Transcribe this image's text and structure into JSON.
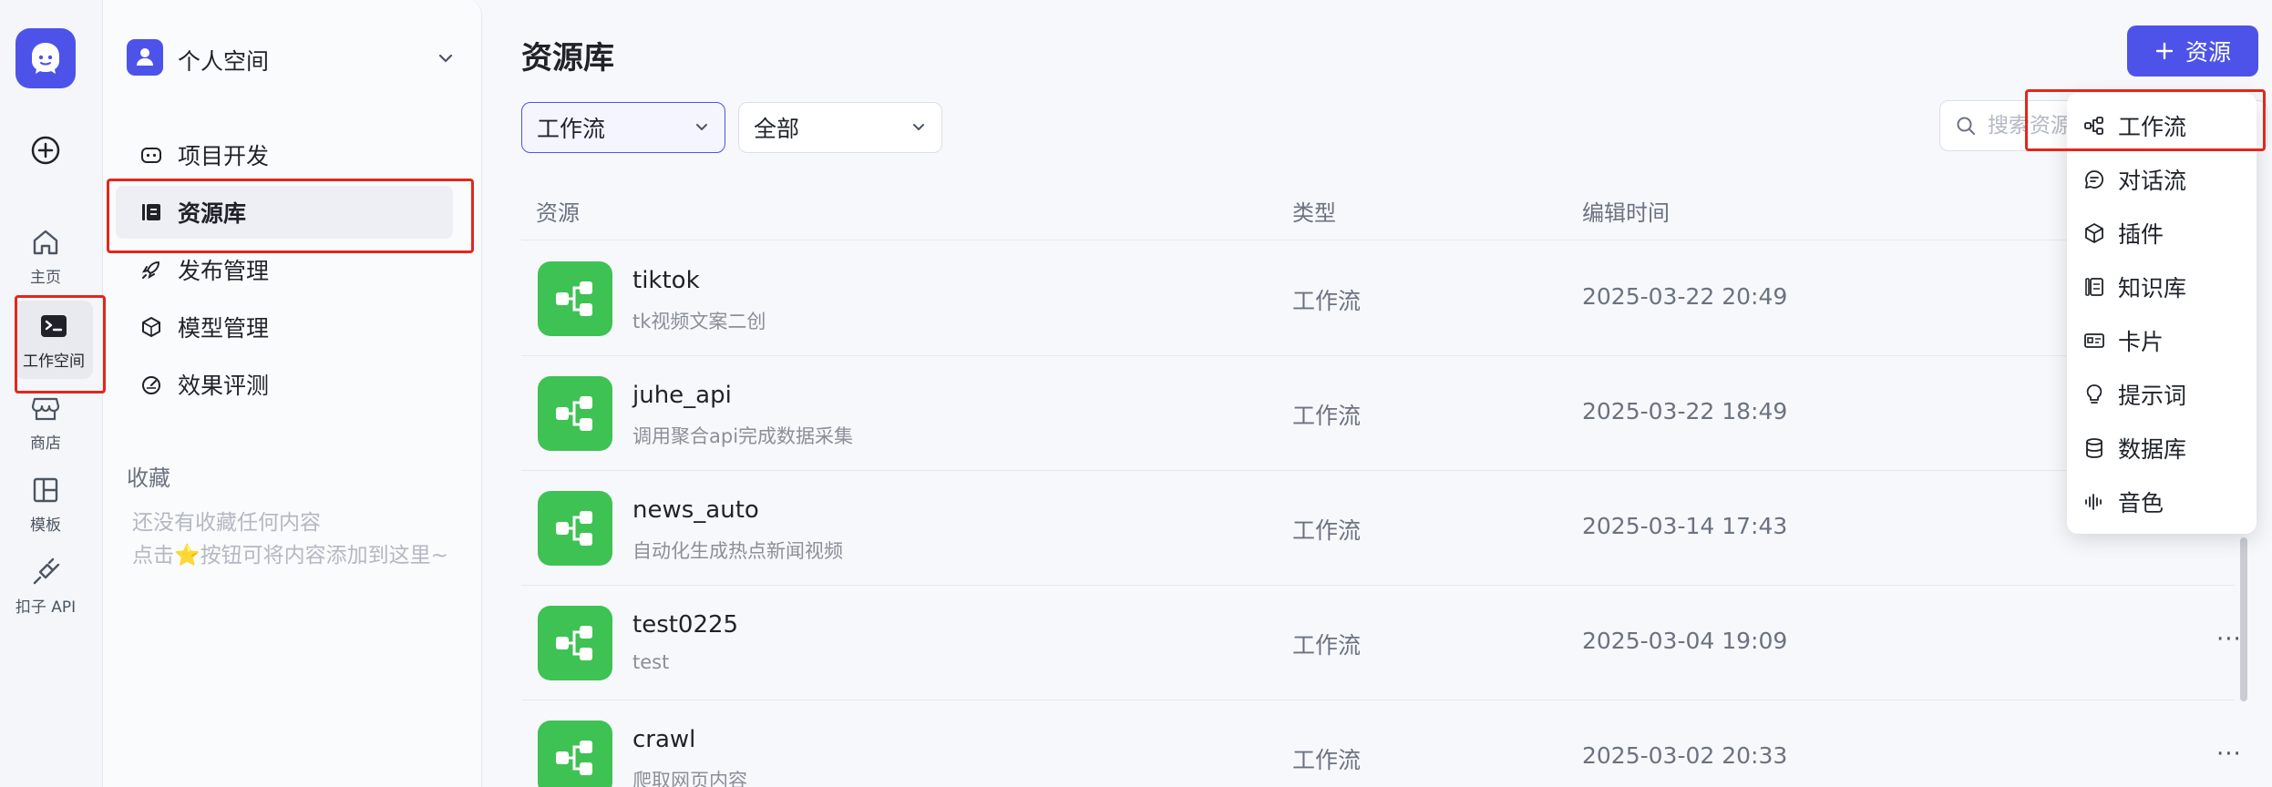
{
  "rail": {
    "items": [
      {
        "label": "主页",
        "icon": "home-icon"
      },
      {
        "label": "工作空间",
        "icon": "terminal-icon"
      },
      {
        "label": "商店",
        "icon": "store-icon"
      },
      {
        "label": "模板",
        "icon": "template-icon"
      },
      {
        "label": "扣子 API",
        "icon": "api-icon"
      }
    ]
  },
  "sidebar": {
    "space_name": "个人空间",
    "nav": [
      {
        "label": "项目开发",
        "icon": "robot-icon"
      },
      {
        "label": "资源库",
        "icon": "library-icon"
      },
      {
        "label": "发布管理",
        "icon": "rocket-icon"
      },
      {
        "label": "模型管理",
        "icon": "model-icon"
      },
      {
        "label": "效果评测",
        "icon": "gauge-icon"
      }
    ],
    "favorites_title": "收藏",
    "favorites_empty_line1": "还没有收藏任何内容",
    "favorites_empty_line2": "点击⭐按钮可将内容添加到这里~"
  },
  "main": {
    "title": "资源库",
    "add_button": "资源",
    "filter_type": "工作流",
    "filter_scope": "全部",
    "search_placeholder": "搜索资源"
  },
  "table": {
    "headers": {
      "resource": "资源",
      "type": "类型",
      "edited": "编辑时间"
    },
    "rows": [
      {
        "name": "tiktok",
        "desc": "tk视频文案二创",
        "type": "工作流",
        "time": "2025-03-22 20:49"
      },
      {
        "name": "juhe_api",
        "desc": "调用聚合api完成数据采集",
        "type": "工作流",
        "time": "2025-03-22 18:49"
      },
      {
        "name": "news_auto",
        "desc": "自动化生成热点新闻视频",
        "type": "工作流",
        "time": "2025-03-14 17:43"
      },
      {
        "name": "test0225",
        "desc": "test",
        "type": "工作流",
        "time": "2025-03-04 19:09"
      },
      {
        "name": "crawl",
        "desc": "爬取网页内容",
        "type": "工作流",
        "time": "2025-03-02 20:33"
      }
    ]
  },
  "dropdown": {
    "items": [
      {
        "label": "工作流",
        "icon": "workflow-icon"
      },
      {
        "label": "对话流",
        "icon": "chatflow-icon"
      },
      {
        "label": "插件",
        "icon": "plugin-icon"
      },
      {
        "label": "知识库",
        "icon": "knowledge-icon"
      },
      {
        "label": "卡片",
        "icon": "card-icon"
      },
      {
        "label": "提示词",
        "icon": "prompt-icon"
      },
      {
        "label": "数据库",
        "icon": "database-icon"
      },
      {
        "label": "音色",
        "icon": "voice-icon"
      }
    ]
  },
  "colors": {
    "accent": "#4d53e8",
    "workflow_green": "#3ec254",
    "annotation_red": "#e3271c"
  }
}
